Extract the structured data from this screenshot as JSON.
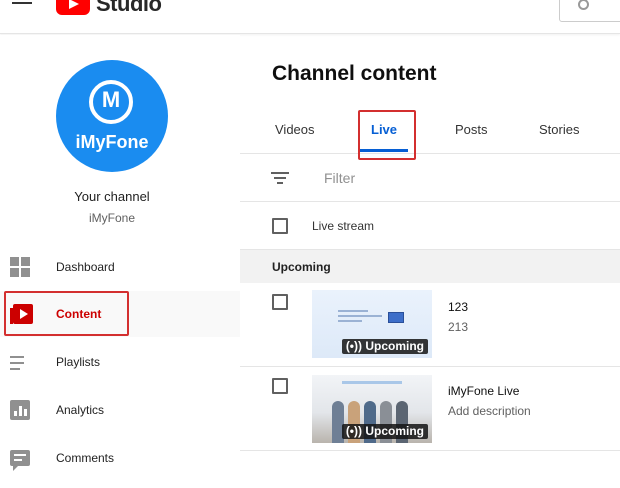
{
  "app": {
    "brand": "Studio"
  },
  "sidebar": {
    "avatar_text": "iMyFone",
    "channel_title": "Your channel",
    "channel_name": "iMyFone",
    "items": [
      {
        "label": "Dashboard",
        "icon": "dashboard-icon"
      },
      {
        "label": "Content",
        "icon": "content-icon",
        "active": true
      },
      {
        "label": "Playlists",
        "icon": "playlists-icon"
      },
      {
        "label": "Analytics",
        "icon": "analytics-icon"
      },
      {
        "label": "Comments",
        "icon": "comments-icon"
      }
    ]
  },
  "main": {
    "title": "Channel content",
    "tabs": [
      {
        "label": "Videos"
      },
      {
        "label": "Live",
        "active": true
      },
      {
        "label": "Posts"
      },
      {
        "label": "Stories"
      }
    ],
    "filter_placeholder": "Filter",
    "column_header": "Live stream",
    "section_label": "Upcoming",
    "rows": [
      {
        "title": "123",
        "description": "213",
        "badge": "(•)) Upcoming"
      },
      {
        "title": "iMyFone Live",
        "description": "Add description",
        "badge": "(•)) Upcoming"
      }
    ]
  },
  "colors": {
    "accent": "#065fd4",
    "brand_red": "#ff0000",
    "active_nav": "#cc0000",
    "highlight": "#d32f2f",
    "avatar_blue": "#1a8cf0"
  }
}
